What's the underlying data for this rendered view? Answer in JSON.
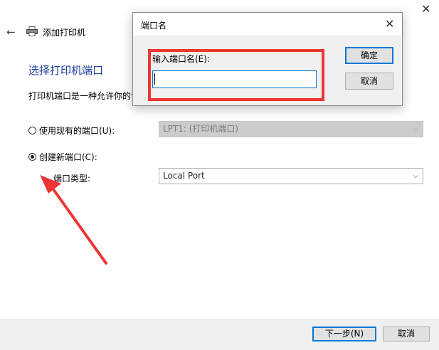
{
  "wizard": {
    "title": "添加打印机",
    "heading": "选择打印机端口",
    "description": "打印机端口是一种允许你的计",
    "existing_port": {
      "label": "使用现有的端口(U):",
      "selected": false,
      "value": "LPT1: (打印机端口)",
      "enabled": false
    },
    "new_port": {
      "label": "创建新端口(C):",
      "selected": true,
      "type_label": "端口类型:",
      "type_value": "Local Port"
    },
    "footer": {
      "next_label": "下一步(N)",
      "cancel_label": "取消"
    }
  },
  "dialog": {
    "title": "端口名",
    "field_label": "输入端口名(E):",
    "field_value": "",
    "ok_label": "确定",
    "cancel_label": "取消"
  },
  "icons": {
    "back": "back-arrow-icon",
    "printer": "printer-icon",
    "close": "close-icon",
    "dropdown": "chevron-down-icon"
  },
  "colors": {
    "heading": "#1a3a9c",
    "annotation": "#ee3535",
    "focus": "#0078d7"
  }
}
